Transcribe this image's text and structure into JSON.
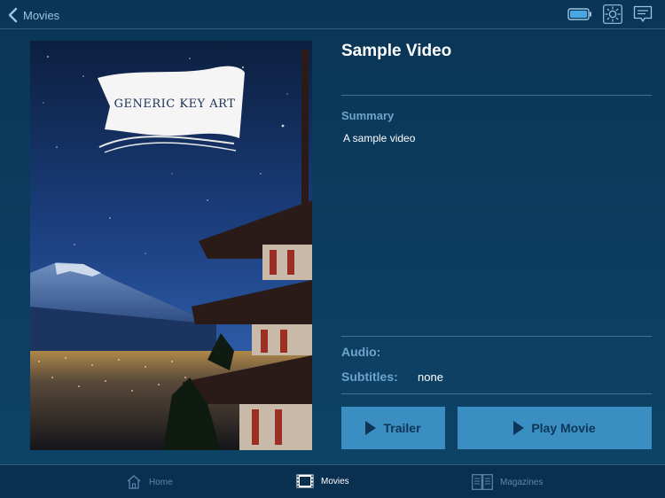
{
  "topbar": {
    "back_label": "Movies",
    "icons": [
      "battery-icon",
      "brightness-icon",
      "subtitles-icon"
    ]
  },
  "poster": {
    "banner_text": "GENERIC KEY ART"
  },
  "movie": {
    "title": "Sample Video",
    "summary_heading": "Summary",
    "summary_text": "A sample video",
    "audio_label": "Audio:",
    "subtitles_label": "Subtitles:",
    "subtitles_value": "none"
  },
  "actions": {
    "trailer_label": "Trailer",
    "play_label": "Play Movie"
  },
  "tabbar": {
    "items": [
      {
        "label": "Home",
        "icon": "home-icon",
        "active": false
      },
      {
        "label": "Movies",
        "icon": "film-icon",
        "active": true
      },
      {
        "label": "Magazines",
        "icon": "magazine-icon",
        "active": false
      }
    ]
  },
  "colors": {
    "background": "#0b3c5f",
    "accent_button": "#3b8ec1",
    "label_blue": "#6fa3cb"
  }
}
